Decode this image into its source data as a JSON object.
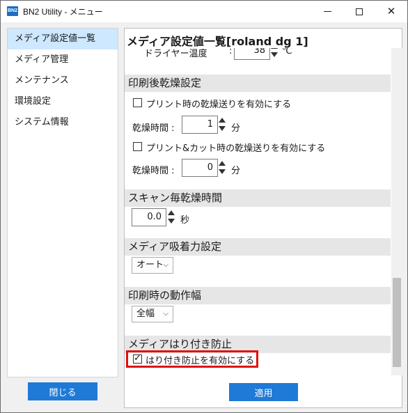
{
  "window": {
    "app_icon_text": "BN2",
    "title": "BN2 Utility - メニュー"
  },
  "sidebar": {
    "items": [
      {
        "label": "メディア設定値一覧",
        "active": true
      },
      {
        "label": "メディア管理",
        "active": false
      },
      {
        "label": "メンテナンス",
        "active": false
      },
      {
        "label": "環境設定",
        "active": false
      },
      {
        "label": "システム情報",
        "active": false
      }
    ],
    "close_label": "閉じる"
  },
  "main": {
    "title": "メディア設定値一覧[roland dg 1]",
    "dryer_temp": {
      "label": "ドライヤー温度",
      "colon": ":",
      "value": "38",
      "unit": "℃"
    },
    "post_print_dry": {
      "header": "印刷後乾燥設定",
      "print_feed_label": "プリント時の乾燥送りを有効にする",
      "print_feed_checked": false,
      "dry_time_label": "乾燥時間 :",
      "dry_time_value": "1",
      "dry_time_unit": "分",
      "printcut_feed_label": "プリント&カット時の乾燥送りを有効にする",
      "printcut_feed_checked": false,
      "dry_time2_label": "乾燥時間 :",
      "dry_time2_value": "0",
      "dry_time2_unit": "分"
    },
    "scan_dry": {
      "header": "スキャン毎乾燥時間",
      "value": "0.0",
      "unit": "秒"
    },
    "vacuum": {
      "header": "メディア吸着力設定",
      "selected": "オート"
    },
    "print_width": {
      "header": "印刷時の動作幅",
      "selected": "全幅"
    },
    "anti_stick": {
      "header": "メディアはり付き防止",
      "checkbox_label": "はり付き防止を有効にする",
      "checked": true,
      "highlight_color": "#e01010"
    },
    "apply_label": "適用"
  },
  "colors": {
    "accent": "#1e7ad6",
    "sidebar_active": "#cde8ff",
    "section_header_bg": "#e6e6e6"
  }
}
